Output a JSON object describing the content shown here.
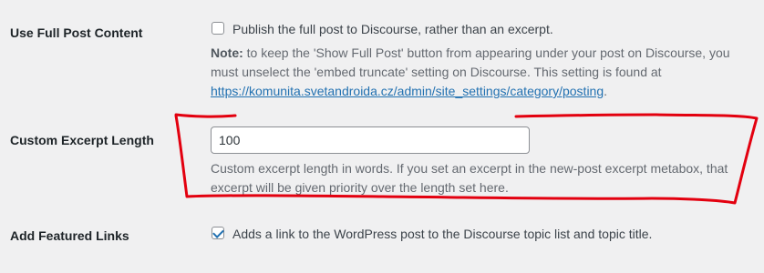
{
  "settings": {
    "full_post": {
      "label": "Use Full Post Content",
      "checkbox_label": "Publish the full post to Discourse, rather than an excerpt.",
      "checked": false,
      "note_prefix": "Note:",
      "note_text": " to keep the 'Show Full Post' button from appearing under your post on Discourse, you must unselect the 'embed truncate' setting on Discourse. This setting is found at ",
      "note_link": "https://komunita.svetandroida.cz/admin/site_settings/category/posting",
      "note_suffix": "."
    },
    "excerpt_length": {
      "label": "Custom Excerpt Length",
      "value": "100",
      "description": "Custom excerpt length in words. If you set an excerpt in the new-post excerpt metabox, that excerpt will be given priority over the length set here."
    },
    "featured_links": {
      "label": "Add Featured Links",
      "checkbox_label": "Adds a link to the WordPress post to the Discourse topic list and topic title.",
      "checked": true
    }
  },
  "annotation": {
    "color": "#e3000f"
  }
}
